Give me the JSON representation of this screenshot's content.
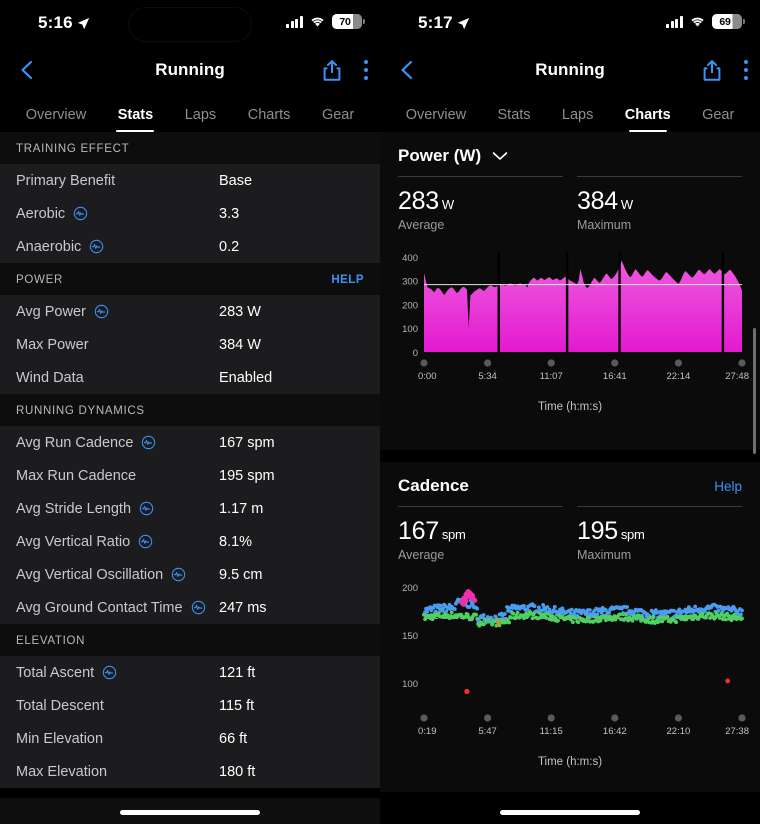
{
  "left": {
    "status": {
      "time": "5:16",
      "battery": "70",
      "location_icon": "location-arrow-icon",
      "wifi_icon": "wifi-icon",
      "signal_icon": "cellular-bars-icon"
    },
    "nav": {
      "title": "Running",
      "back_icon": "back-chevron-icon",
      "share_icon": "share-icon",
      "menu_icon": "overflow-menu-icon"
    },
    "tabs": [
      {
        "label": "Overview",
        "active": false
      },
      {
        "label": "Stats",
        "active": true
      },
      {
        "label": "Laps",
        "active": false
      },
      {
        "label": "Charts",
        "active": false
      },
      {
        "label": "Gear",
        "active": false
      }
    ],
    "sections": [
      {
        "title": "TRAINING EFFECT",
        "help": "",
        "rows": [
          {
            "label": "Primary Benefit",
            "value": "Base",
            "info": false
          },
          {
            "label": "Aerobic",
            "value": "3.3",
            "info": true
          },
          {
            "label": "Anaerobic",
            "value": "0.2",
            "info": true
          }
        ]
      },
      {
        "title": "POWER",
        "help": "HELP",
        "rows": [
          {
            "label": "Avg Power",
            "value": "283 W",
            "info": true
          },
          {
            "label": "Max Power",
            "value": "384 W",
            "info": false
          },
          {
            "label": "Wind Data",
            "value": "Enabled",
            "info": false
          }
        ]
      },
      {
        "title": "RUNNING DYNAMICS",
        "help": "",
        "rows": [
          {
            "label": "Avg Run Cadence",
            "value": "167 spm",
            "info": true
          },
          {
            "label": "Max Run Cadence",
            "value": "195 spm",
            "info": false
          },
          {
            "label": "Avg Stride Length",
            "value": "1.17 m",
            "info": true
          },
          {
            "label": "Avg Vertical Ratio",
            "value": "8.1%",
            "info": true
          },
          {
            "label": "Avg Vertical Oscillation",
            "value": "9.5 cm",
            "info": true
          },
          {
            "label": "Avg Ground Contact Time",
            "value": "247 ms",
            "info": true
          }
        ]
      },
      {
        "title": "ELEVATION",
        "help": "",
        "rows": [
          {
            "label": "Total Ascent",
            "value": "121 ft",
            "info": true
          },
          {
            "label": "Total Descent",
            "value": "115 ft",
            "info": false
          },
          {
            "label": "Min Elevation",
            "value": "66 ft",
            "info": false
          },
          {
            "label": "Max Elevation",
            "value": "180 ft",
            "info": false
          }
        ]
      }
    ]
  },
  "right": {
    "status": {
      "time": "5:17",
      "battery": "69",
      "location_icon": "location-arrow-icon",
      "wifi_icon": "wifi-icon",
      "signal_icon": "cellular-bars-icon"
    },
    "nav": {
      "title": "Running",
      "back_icon": "back-chevron-icon",
      "share_icon": "share-icon",
      "menu_icon": "overflow-menu-icon"
    },
    "tabs": [
      {
        "label": "Overview",
        "active": false
      },
      {
        "label": "Stats",
        "active": false
      },
      {
        "label": "Laps",
        "active": false
      },
      {
        "label": "Charts",
        "active": true
      },
      {
        "label": "Gear",
        "active": false
      }
    ],
    "cards": [
      {
        "title": "Power (W)",
        "has_dropdown": true,
        "help": "",
        "summary": [
          {
            "value": "283",
            "unit": "W",
            "label": "Average"
          },
          {
            "value": "384",
            "unit": "W",
            "label": "Maximum"
          }
        ]
      },
      {
        "title": "Cadence",
        "has_dropdown": false,
        "help": "Help",
        "summary": [
          {
            "value": "167",
            "unit": "spm",
            "label": "Average"
          },
          {
            "value": "195",
            "unit": "spm",
            "label": "Maximum"
          }
        ]
      }
    ]
  },
  "colors": {
    "accent_blue": "#3c93f7",
    "power_fill_top": "#ef5ae0",
    "power_fill_bottom": "#e21ad0",
    "cadence_blue": "#4a9cf0",
    "cadence_green": "#4ad45e",
    "cadence_pink": "#ef2fae",
    "cadence_red": "#f03030",
    "cadence_orange": "#f08030",
    "card_bg": "#0b0b0b",
    "row_bg": "#1c1c1e",
    "section_bg": "#0d0d0d"
  },
  "chart_data": [
    {
      "type": "area",
      "title": "Power (W)",
      "xlabel": "Time (h:m:s)",
      "ylabel": "Power (W)",
      "ylim": [
        0,
        420
      ],
      "yticks": [
        0,
        100,
        200,
        300,
        400
      ],
      "ytick_labels": [
        "0",
        "100",
        "200",
        "300",
        "400"
      ],
      "xtick_labels": [
        "0:00",
        "5:34",
        "11:07",
        "16:41",
        "22:14",
        "27:48"
      ],
      "average_line": 283,
      "grid": false,
      "legend": "none",
      "lap_breaks_pct": [
        23.5,
        45.0,
        61.5,
        94.0
      ],
      "values": [
        332,
        300,
        272,
        268,
        265,
        258,
        250,
        262,
        270,
        266,
        258,
        246,
        240,
        252,
        262,
        268,
        272,
        268,
        258,
        248,
        252,
        262,
        270,
        274,
        270,
        262,
        100,
        238,
        244,
        252,
        258,
        262,
        268,
        266,
        260,
        256,
        264,
        272,
        278,
        280,
        276,
        272,
        274,
        280,
        284,
        286,
        282,
        278,
        280,
        284,
        288,
        286,
        282,
        278,
        282,
        286,
        288,
        284,
        280,
        284,
        270,
        290,
        300,
        308,
        312,
        306,
        300,
        306,
        312,
        308,
        302,
        306,
        312,
        314,
        308,
        302,
        306,
        310,
        306,
        300,
        304,
        310,
        316,
        312,
        306,
        300,
        296,
        292,
        288,
        284,
        300,
        348,
        320,
        288,
        276,
        268,
        276,
        288,
        300,
        312,
        306,
        298,
        290,
        296,
        308,
        318,
        330,
        324,
        314,
        306,
        312,
        320,
        332,
        346,
        360,
        384,
        366,
        348,
        334,
        322,
        314,
        322,
        336,
        348,
        340,
        330,
        322,
        316,
        324,
        336,
        344,
        338,
        330,
        322,
        316,
        310,
        304,
        300,
        306,
        316,
        328,
        336,
        330,
        322,
        314,
        306,
        300,
        292,
        286,
        296,
        312,
        328,
        340,
        334,
        326,
        318,
        312,
        318,
        328,
        338,
        346,
        340,
        332,
        326,
        332,
        340,
        348,
        342,
        334,
        328,
        334,
        342,
        348,
        342,
        334,
        326,
        332,
        340,
        346,
        338,
        328,
        318,
        306,
        292,
        276,
        258
      ]
    },
    {
      "type": "scatter",
      "title": "Cadence",
      "xlabel": "Time (h:m:s)",
      "ylabel": "Cadence (spm)",
      "ylim": [
        80,
        205
      ],
      "yticks": [
        100,
        150,
        200
      ],
      "ytick_labels": [
        "100",
        "150",
        "200"
      ],
      "xtick_labels": [
        "0:19",
        "5:47",
        "11:15",
        "16:42",
        "22:10",
        "27:38"
      ],
      "average_line": 167,
      "grid": false,
      "legend": "none",
      "series": [
        {
          "name": "upper-band-blue",
          "color": "#4a9cf0",
          "base": 175,
          "noise": 5
        },
        {
          "name": "lower-band-green",
          "color": "#4ad45e",
          "base": 168,
          "noise": 4
        },
        {
          "name": "spike-pink",
          "color": "#ef2fae",
          "values": [
            184,
            188,
            192,
            195,
            193,
            188
          ]
        },
        {
          "name": "outliers-red",
          "color": "#f03030",
          "values": [
            91,
            102
          ]
        },
        {
          "name": "outlier-orange",
          "color": "#f08030",
          "values": [
            162
          ]
        }
      ]
    }
  ]
}
